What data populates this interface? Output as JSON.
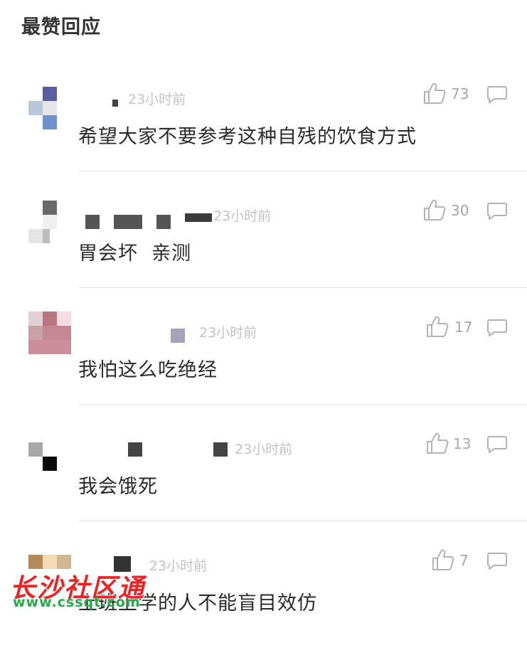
{
  "header": {
    "title": "最赞回应"
  },
  "comments": [
    {
      "time": "23小时前",
      "likes": "73",
      "content": "希望大家不要参考这种自残的饮食方式"
    },
    {
      "time": "23小时前",
      "likes": "30",
      "content": "胃会坏  亲测"
    },
    {
      "time": "23小时前",
      "likes": "17",
      "content": "我怕这么吃绝经"
    },
    {
      "time": "23小时前",
      "likes": "13",
      "content": "我会饿死"
    },
    {
      "time": "23小时前",
      "likes": "7",
      "content": "上班上学的人不能盲目效仿"
    }
  ],
  "icons": {
    "like": "thumbs-up-icon",
    "reply": "comment-bubble-icon"
  },
  "colors": {
    "time_text": "#c2c2c2",
    "count_text": "#a7a7a7",
    "icon_stroke": "#b3b3b3",
    "divider": "#e8e8e8",
    "watermark_red": "#ee2222",
    "watermark_green": "#2aa84a"
  },
  "watermark": {
    "text": "长沙社区通",
    "url": "www.cssqt.com"
  }
}
